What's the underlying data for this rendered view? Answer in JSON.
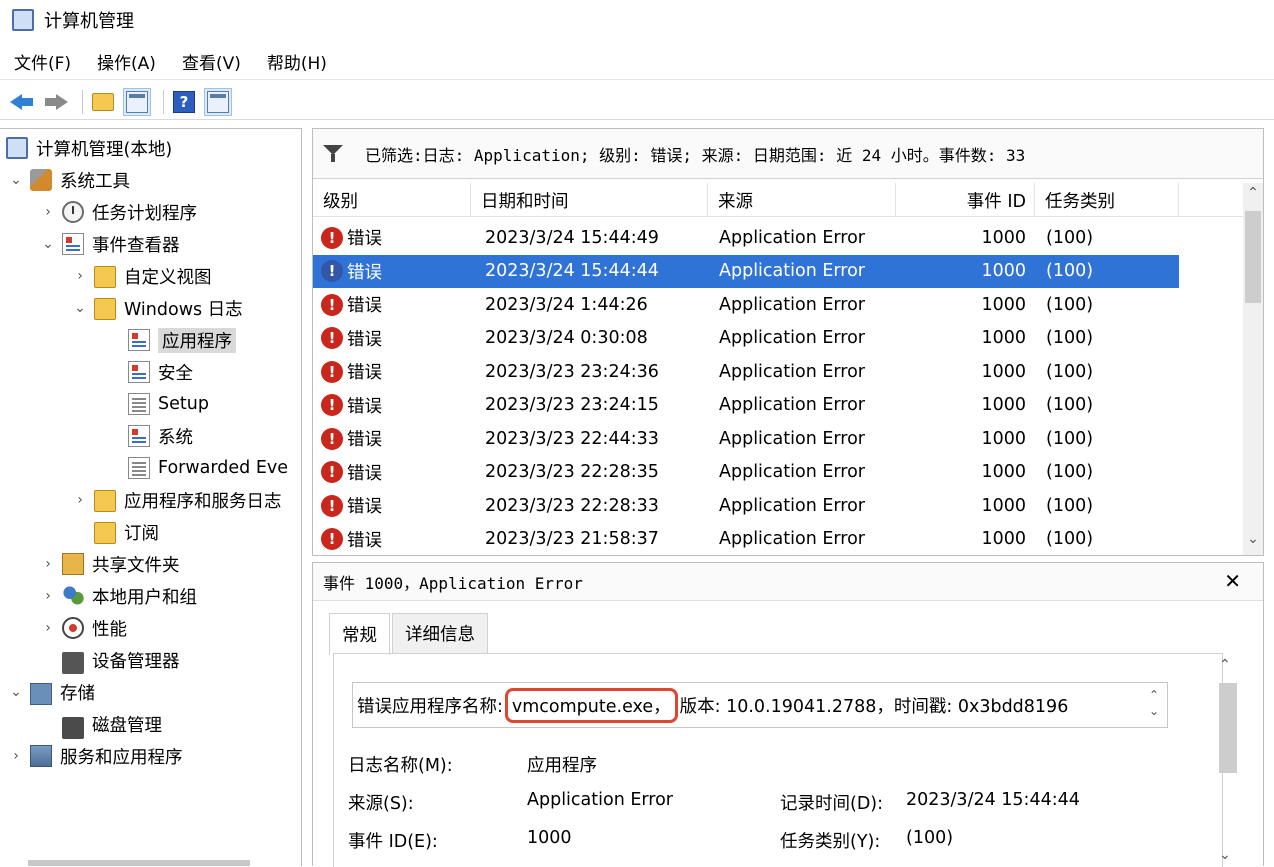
{
  "window": {
    "title": "计算机管理"
  },
  "menu": [
    "文件(F)",
    "操作(A)",
    "查看(V)",
    "帮助(H)"
  ],
  "tree": {
    "items": [
      {
        "label": "计算机管理(本地)",
        "icon": "computer-icon",
        "exp": ""
      },
      {
        "label": "系统工具",
        "icon": "tools-icon",
        "exp": "⌄"
      },
      {
        "label": "任务计划程序",
        "icon": "clock-icon",
        "exp": "›"
      },
      {
        "label": "事件查看器",
        "icon": "event-viewer-icon",
        "exp": "⌄"
      },
      {
        "label": "自定义视图",
        "icon": "folder-icon",
        "exp": "›"
      },
      {
        "label": "Windows 日志",
        "icon": "folder-icon",
        "exp": "⌄"
      },
      {
        "label": "应用程序",
        "icon": "event-log-icon",
        "exp": ""
      },
      {
        "label": "安全",
        "icon": "event-log-icon",
        "exp": ""
      },
      {
        "label": "Setup",
        "icon": "log-icon",
        "exp": ""
      },
      {
        "label": "系统",
        "icon": "event-log-icon",
        "exp": ""
      },
      {
        "label": "Forwarded Eve",
        "icon": "log-icon",
        "exp": ""
      },
      {
        "label": "应用程序和服务日志",
        "icon": "folder-icon",
        "exp": "›"
      },
      {
        "label": "订阅",
        "icon": "subscription-icon",
        "exp": ""
      },
      {
        "label": "共享文件夹",
        "icon": "shared-folder-icon",
        "exp": "›"
      },
      {
        "label": "本地用户和组",
        "icon": "users-icon",
        "exp": "›"
      },
      {
        "label": "性能",
        "icon": "performance-icon",
        "exp": "›"
      },
      {
        "label": "设备管理器",
        "icon": "device-manager-icon",
        "exp": ""
      },
      {
        "label": "存储",
        "icon": "storage-icon",
        "exp": "⌄"
      },
      {
        "label": "磁盘管理",
        "icon": "disk-icon",
        "exp": ""
      },
      {
        "label": "服务和应用程序",
        "icon": "services-icon",
        "exp": "›"
      }
    ]
  },
  "filter": {
    "text": "已筛选:日志: Application; 级别: 错误; 来源: 日期范围: 近 24 小时。事件数: 33"
  },
  "columns": [
    "级别",
    "日期和时间",
    "来源",
    "事件 ID",
    "任务类别"
  ],
  "events": [
    {
      "level": "错误",
      "datetime": "2023/3/24 15:44:49",
      "source": "Application Error",
      "id": "1000",
      "category": "(100)"
    },
    {
      "level": "错误",
      "datetime": "2023/3/24 15:44:44",
      "source": "Application Error",
      "id": "1000",
      "category": "(100)"
    },
    {
      "level": "错误",
      "datetime": "2023/3/24 1:44:26",
      "source": "Application Error",
      "id": "1000",
      "category": "(100)"
    },
    {
      "level": "错误",
      "datetime": "2023/3/24 0:30:08",
      "source": "Application Error",
      "id": "1000",
      "category": "(100)"
    },
    {
      "level": "错误",
      "datetime": "2023/3/23 23:24:36",
      "source": "Application Error",
      "id": "1000",
      "category": "(100)"
    },
    {
      "level": "错误",
      "datetime": "2023/3/23 23:24:15",
      "source": "Application Error",
      "id": "1000",
      "category": "(100)"
    },
    {
      "level": "错误",
      "datetime": "2023/3/23 22:44:33",
      "source": "Application Error",
      "id": "1000",
      "category": "(100)"
    },
    {
      "level": "错误",
      "datetime": "2023/3/23 22:28:35",
      "source": "Application Error",
      "id": "1000",
      "category": "(100)"
    },
    {
      "level": "错误",
      "datetime": "2023/3/23 22:28:33",
      "source": "Application Error",
      "id": "1000",
      "category": "(100)"
    },
    {
      "level": "错误",
      "datetime": "2023/3/23 21:58:37",
      "source": "Application Error",
      "id": "1000",
      "category": "(100)"
    }
  ],
  "detail": {
    "title": "事件 1000，Application Error",
    "tabs": [
      "常规",
      "详细信息"
    ],
    "desc_prefix": "错误应用程序名称:",
    "desc_highlight": "vmcompute.exe，",
    "desc_suffix": "版本: 10.0.19041.2788，时间戳: 0x3bdd8196",
    "log_name_label": "日志名称(M):",
    "log_name_value": "应用程序",
    "source_label": "来源(S):",
    "source_value": "Application Error",
    "logged_label": "记录时间(D):",
    "logged_value": "2023/3/24 15:44:44",
    "event_id_label": "事件 ID(E):",
    "event_id_value": "1000",
    "category_label": "任务类别(Y):",
    "category_value": "(100)"
  }
}
